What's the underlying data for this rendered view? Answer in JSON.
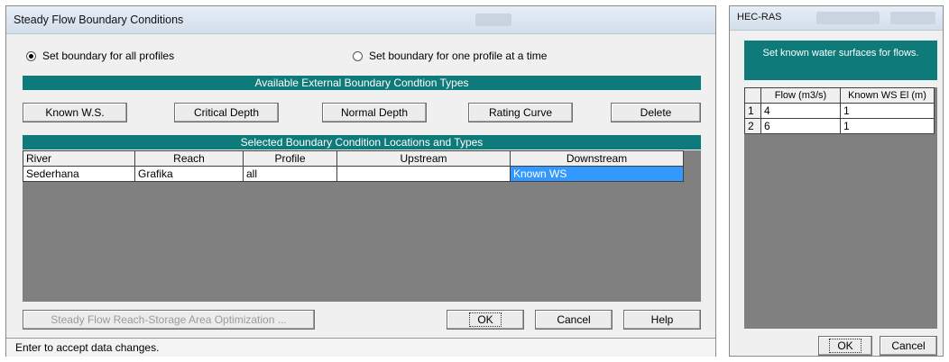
{
  "main_window": {
    "title": "Steady Flow Boundary Conditions",
    "radio_all": "Set boundary for all profiles",
    "radio_one": "Set boundary for one profile at a time",
    "available_header": "Available External Boundary Condtion Types",
    "buttons": {
      "known_ws": "Known W.S.",
      "critical_depth": "Critical Depth",
      "normal_depth": "Normal Depth",
      "rating_curve": "Rating Curve",
      "delete": "Delete"
    },
    "selected_header": "Selected Boundary Condition Locations and Types",
    "columns": [
      "River",
      "Reach",
      "Profile",
      "Upstream",
      "Downstream"
    ],
    "rows": [
      [
        "Sederhana",
        "Grafika",
        "all",
        "",
        "Known WS"
      ]
    ],
    "optimization_button": "Steady Flow Reach-Storage Area Optimization ...",
    "ok": "OK",
    "cancel": "Cancel",
    "help": "Help",
    "status": "Enter to accept data changes."
  },
  "side_window": {
    "title": "HEC-RAS",
    "header": "Set known water surfaces for flows.",
    "columns": [
      "Flow (m3/s)",
      "Known WS El (m)"
    ],
    "rows": [
      {
        "n": "1",
        "flow": "4",
        "ws": "1"
      },
      {
        "n": "2",
        "flow": "6",
        "ws": "1"
      }
    ],
    "ok": "OK",
    "cancel": "Cancel"
  },
  "colors": {
    "band": "#0f7a7a",
    "selection": "#3399ff",
    "grid_bg": "#808080"
  }
}
